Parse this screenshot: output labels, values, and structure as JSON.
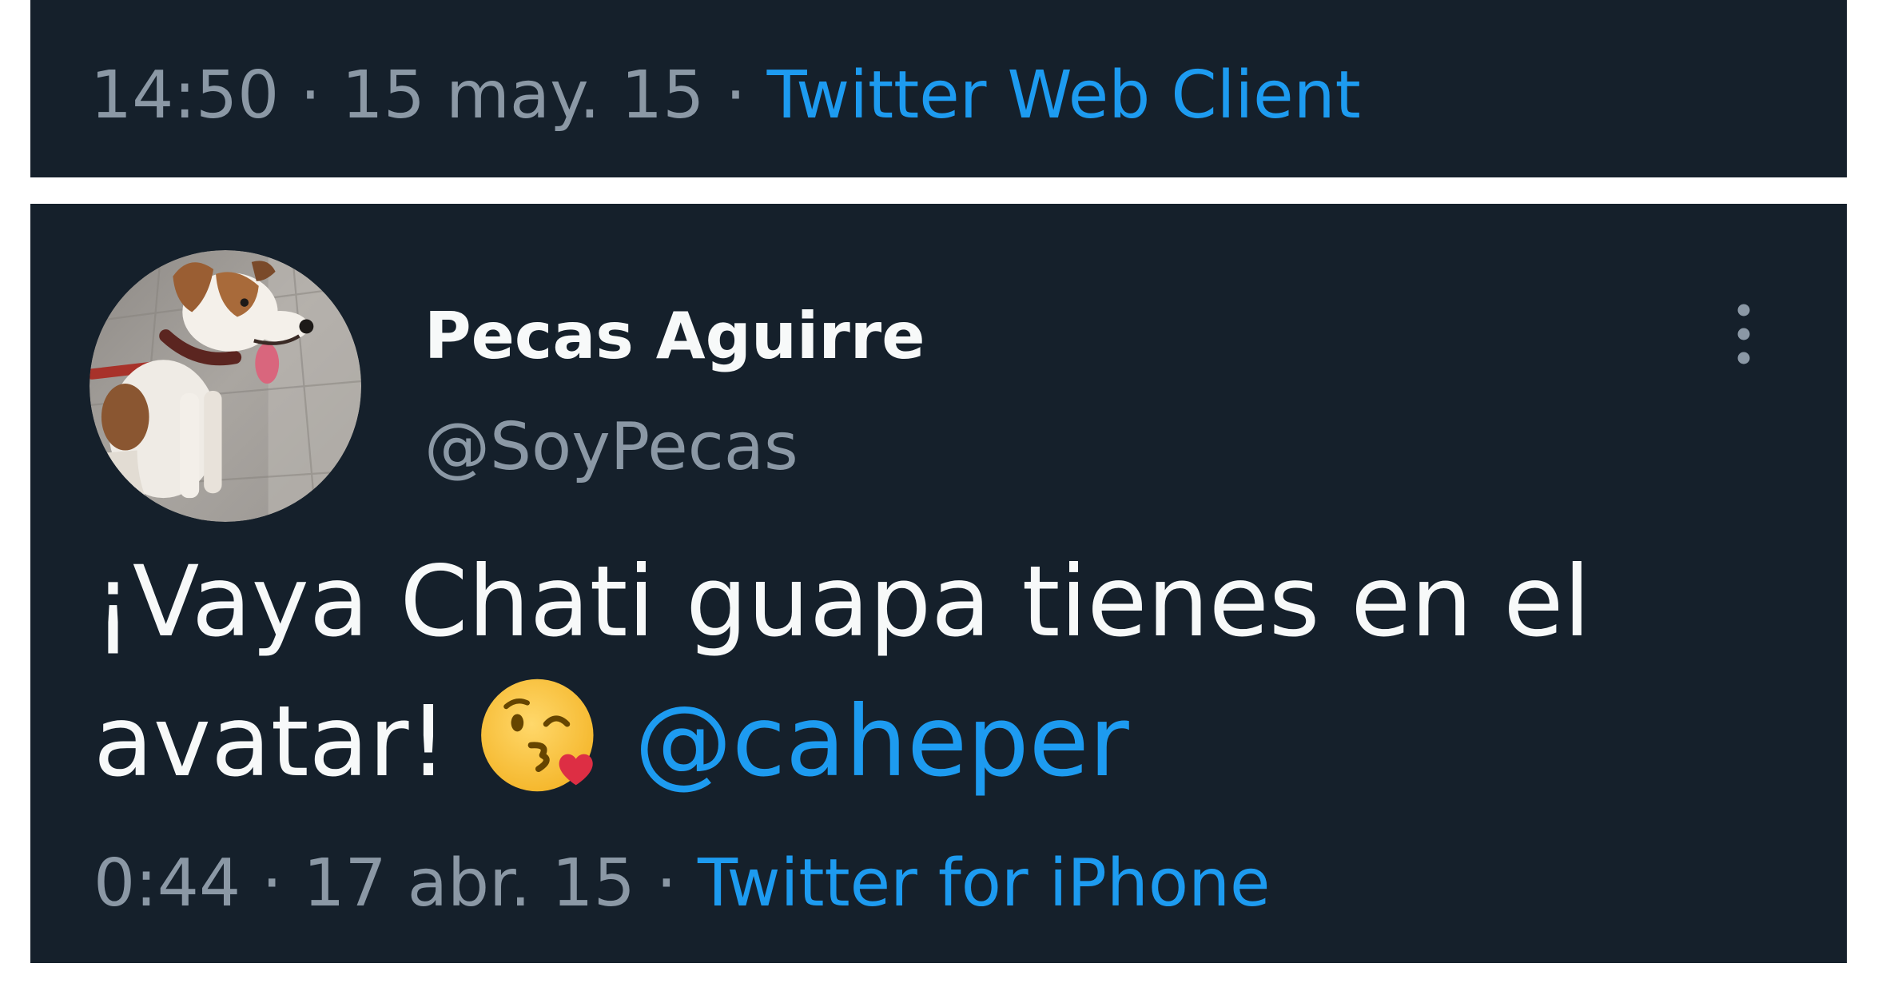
{
  "theme": {
    "page": "#ffffff",
    "background": "#15202b",
    "text": "#f7f9f9",
    "secondary": "#8b98a5",
    "accent": "#1d9bf0"
  },
  "separator": "·",
  "previous_tweet": {
    "time": "14:50",
    "date": "15 may. 15",
    "source": "Twitter Web Client"
  },
  "tweet": {
    "author": {
      "name": "Pecas Aguirre",
      "handle": "@SoyPecas",
      "avatar": "dog-photo"
    },
    "text": "¡Vaya Chati guapa tienes en el avatar!",
    "emoji": "face-blowing-kiss",
    "mention": "@caheper",
    "time": "0:44",
    "date": "17 abr. 15",
    "source": "Twitter for iPhone"
  },
  "icons": {
    "more": "more-vertical-icon"
  }
}
